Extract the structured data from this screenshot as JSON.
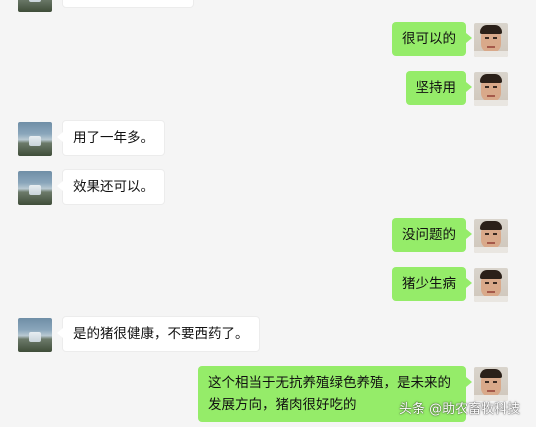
{
  "messages": [
    {
      "side": "me",
      "text": "很可以的"
    },
    {
      "side": "me",
      "text": "坚持用"
    },
    {
      "side": "other",
      "text": "用了一年多。"
    },
    {
      "side": "other",
      "text": "效果还可以。"
    },
    {
      "side": "me",
      "text": "没问题的"
    },
    {
      "side": "me",
      "text": "猪少生病"
    },
    {
      "side": "other",
      "text": "是的猪很健康，不要西药了。"
    },
    {
      "side": "me",
      "text": "这个相当于无抗养殖绿色养殖，是未来的发展方向，猪肉很好吃的"
    }
  ],
  "watermark": {
    "text": "头条 @助农畜牧科技"
  },
  "colors": {
    "background": "#f5f5f5",
    "my_bubble": "#95ec69",
    "other_bubble": "#ffffff"
  },
  "icons": {
    "other_avatar": "waterfall-landscape-avatar",
    "my_avatar": "man-portrait-avatar"
  }
}
